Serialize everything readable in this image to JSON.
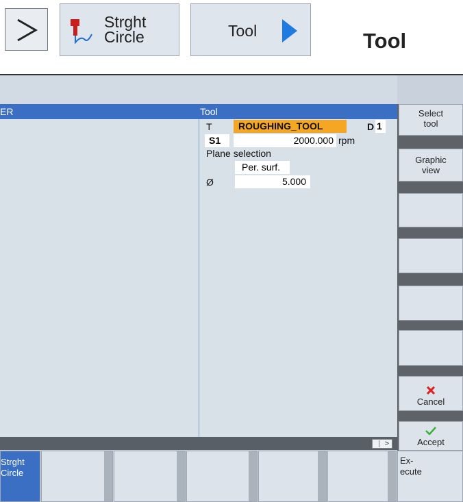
{
  "header": {
    "chevron_label": ">",
    "strght_circle_label_1": "Strght",
    "strght_circle_label_2": "Circle",
    "tool_button_label": "Tool",
    "heading": "Tool"
  },
  "screen": {
    "title_left": "ER",
    "title_tool": "Tool",
    "fields": {
      "t_label": "T",
      "t_value": "ROUGHING_TOOL",
      "d_label": "D",
      "d_value": "1",
      "s_label": "S1",
      "s_value": "2000.000",
      "s_unit": "rpm",
      "plane_label": "Plane selection",
      "plane_value": "Per. surf.",
      "diameter_label": "Ø",
      "diameter_value": "5.000"
    },
    "status_indicator": ">"
  },
  "softkeys_right": [
    {
      "line1": "Select",
      "line2": "tool"
    },
    {
      "line1": "Graphic",
      "line2": "view"
    },
    {
      "line1": "",
      "line2": ""
    },
    {
      "line1": "",
      "line2": ""
    },
    {
      "line1": "",
      "line2": ""
    },
    {
      "line1": "",
      "line2": ""
    },
    {
      "line1": "Cancel",
      "line2": ""
    },
    {
      "line1": "Accept",
      "line2": ""
    }
  ],
  "softkeys_bottom": [
    {
      "line1": "Strght",
      "line2": "Circle"
    },
    {
      "line1": "",
      "line2": ""
    },
    {
      "line1": "",
      "line2": ""
    },
    {
      "line1": "",
      "line2": ""
    },
    {
      "line1": "",
      "line2": ""
    },
    {
      "line1": "",
      "line2": ""
    }
  ],
  "execute_key": {
    "line1": "Ex-",
    "line2": "ecute"
  },
  "colors": {
    "title_bar": "#3b6fc3",
    "tool_highlight": "#f5a623",
    "cancel_icon": "#e02020",
    "accept_icon": "#3cae3c",
    "arrow_icon": "#1f7be0"
  }
}
